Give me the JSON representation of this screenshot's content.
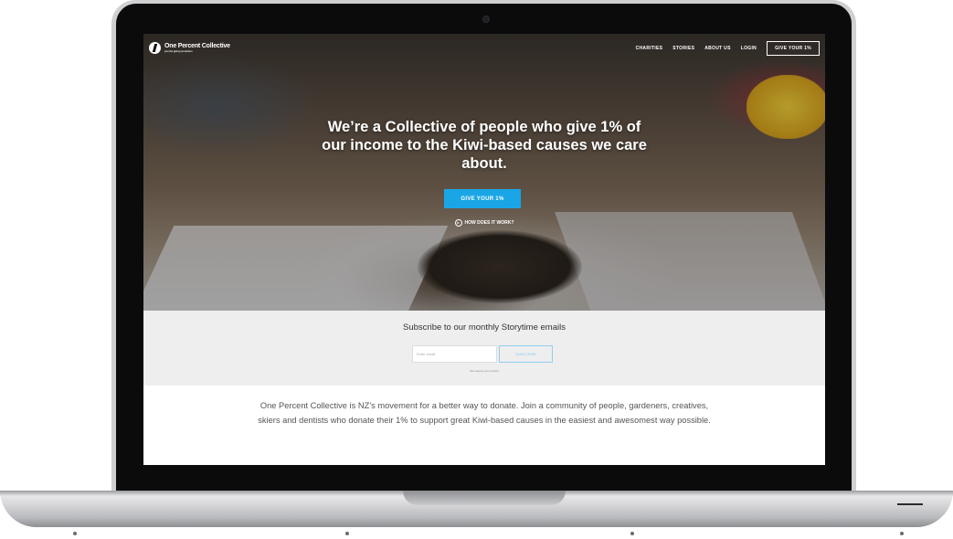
{
  "site": {
    "logo_text": "One Percent Collective",
    "logo_subtext": "join the giving revolution"
  },
  "nav": {
    "items": [
      "CHARITIES",
      "STORIES",
      "ABOUT US",
      "LOGIN"
    ],
    "cta": "GIVE YOUR 1%"
  },
  "hero": {
    "headline": "We’re a Collective of people who give 1% of our income to the Kiwi-based causes we care about.",
    "button": "GIVE YOUR 1%",
    "how_link": "HOW DOES IT WORK?",
    "button_color": "#1aa6e6"
  },
  "subscribe": {
    "title": "Subscribe to our monthly Storytime emails",
    "input_placeholder": "Enter email",
    "button": "SUBSCRIBE",
    "note": "We respect your privacy"
  },
  "about": {
    "text": "One Percent Collective is NZ’s movement for a better way to donate. Join a community of people, gardeners, creatives, skiers and dentists who donate their 1% to support great Kiwi-based causes in the easiest and awesomest way possible."
  }
}
